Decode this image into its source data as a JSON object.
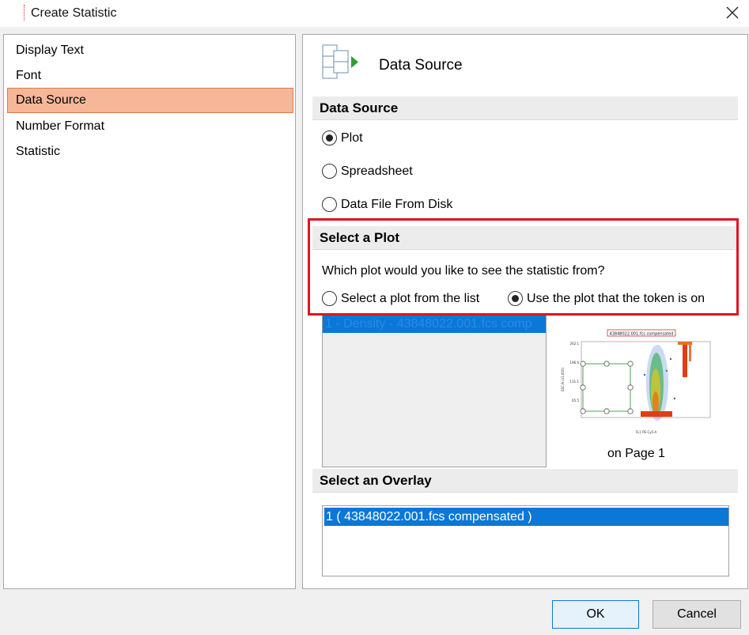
{
  "window": {
    "title": "Create Statistic",
    "close_icon": "close-icon"
  },
  "nav": {
    "items": [
      {
        "label": "Display Text"
      },
      {
        "label": "Font"
      },
      {
        "label": "Data Source"
      },
      {
        "label": "Number Format"
      },
      {
        "label": "Statistic"
      }
    ],
    "selected": "Data Source",
    "selected_color": "#f5b797"
  },
  "header": {
    "title": "Data Source",
    "icon": "data-source-icon"
  },
  "data_source": {
    "section_title": "Data Source",
    "options": [
      {
        "label": "Plot",
        "checked": true
      },
      {
        "label": "Spreadsheet",
        "checked": false
      },
      {
        "label": "Data File From Disk",
        "checked": false
      }
    ]
  },
  "select_plot": {
    "section_title": "Select a Plot",
    "question": "Which plot would you like to see the statistic from?",
    "options": [
      {
        "label": "Select a plot from the list",
        "checked": false
      },
      {
        "label": "Use the plot that the token is on",
        "checked": true
      }
    ],
    "highlight_color": "#e1141e",
    "list_items": [
      "1 - Density - 43848022.001.fcs comp"
    ],
    "preview": {
      "title": "43848022.001.fcs compensated",
      "y_axis_label": "SSC-A (x1,000)",
      "y_ticks": [
        "262.1",
        "196.6",
        "131.1",
        "65.5"
      ],
      "x_axis_label": "FL1 PE-Cy5-A",
      "page_label": "on Page 1"
    }
  },
  "select_overlay": {
    "section_title": "Select an Overlay",
    "items": [
      "1 ( 43848022.001.fcs compensated )"
    ]
  },
  "buttons": {
    "ok": "OK",
    "cancel": "Cancel"
  },
  "colors": {
    "selection_blue": "#0a78d7",
    "accent_green": "#2e9e2e"
  }
}
